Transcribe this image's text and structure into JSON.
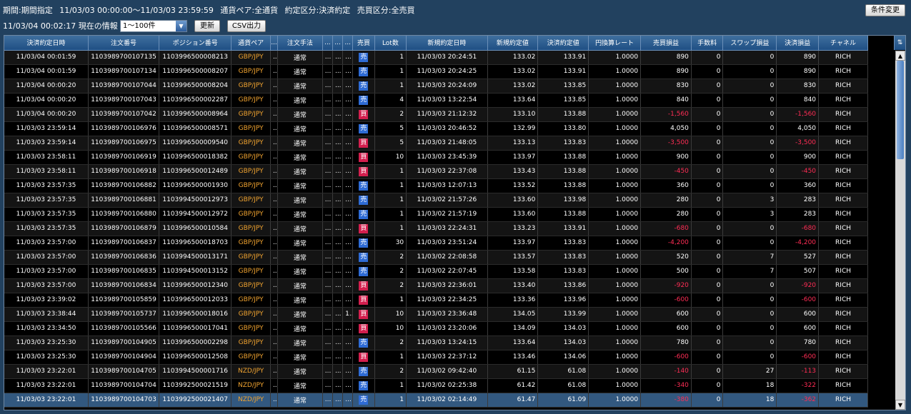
{
  "header": {
    "period_label": "期間:期間指定",
    "period_value": "11/03/03 00:00:00〜11/03/03 23:59:59",
    "pair_filter": "通貨ペア:全通貨",
    "execution_filter": "約定区分:決済約定",
    "side_filter": "売買区分:全売買",
    "condition_button": "条件変更",
    "current_info": "11/03/04 00:02:17 現在の情報",
    "range_value": "1〜100件",
    "update_button": "更新",
    "csv_button": "CSV出力"
  },
  "columns": [
    "決済約定日時",
    "注文番号",
    "ポジション番号",
    "通貨ペア",
    "...",
    "注文手法",
    "...",
    "...",
    "...",
    "売買",
    "Lot数",
    "新規約定日時",
    "新規約定値",
    "決済約定値",
    "円換算レート",
    "売買損益",
    "手数料",
    "スワップ損益",
    "決済損益",
    "チャネル"
  ],
  "rows": [
    [
      "11/03/04 00:01:59",
      "1103989700107135",
      "1103996500008213",
      "GBP/JPY",
      "...",
      "通常",
      "...",
      "...",
      "...",
      "売",
      "1",
      "11/03/03 20:24:51",
      "133.02",
      "133.91",
      "1.0000",
      "890",
      "0",
      "0",
      "890",
      "RICH"
    ],
    [
      "11/03/04 00:01:59",
      "1103989700107134",
      "1103996500008207",
      "GBP/JPY",
      "...",
      "通常",
      "...",
      "...",
      "...",
      "売",
      "1",
      "11/03/03 20:24:25",
      "133.02",
      "133.91",
      "1.0000",
      "890",
      "0",
      "0",
      "890",
      "RICH"
    ],
    [
      "11/03/04 00:00:20",
      "1103989700107044",
      "1103996500008204",
      "GBP/JPY",
      "...",
      "通常",
      "...",
      "...",
      "...",
      "売",
      "1",
      "11/03/03 20:24:09",
      "133.02",
      "133.85",
      "1.0000",
      "830",
      "0",
      "0",
      "830",
      "RICH"
    ],
    [
      "11/03/04 00:00:20",
      "1103989700107043",
      "1103996500002287",
      "GBP/JPY",
      "...",
      "通常",
      "...",
      "...",
      "...",
      "売",
      "4",
      "11/03/03 13:22:54",
      "133.64",
      "133.85",
      "1.0000",
      "840",
      "0",
      "0",
      "840",
      "RICH"
    ],
    [
      "11/03/04 00:00:20",
      "1103989700107042",
      "1103996500008964",
      "GBP/JPY",
      "...",
      "通常",
      "...",
      "...",
      "...",
      "買",
      "2",
      "11/03/03 21:12:32",
      "133.10",
      "133.88",
      "1.0000",
      "-1,560",
      "0",
      "0",
      "-1,560",
      "RICH"
    ],
    [
      "11/03/03 23:59:14",
      "1103989700106976",
      "1103996500008571",
      "GBP/JPY",
      "...",
      "通常",
      "...",
      "...",
      "...",
      "売",
      "5",
      "11/03/03 20:46:52",
      "132.99",
      "133.80",
      "1.0000",
      "4,050",
      "0",
      "0",
      "4,050",
      "RICH"
    ],
    [
      "11/03/03 23:59:14",
      "1103989700106975",
      "1103996500009540",
      "GBP/JPY",
      "...",
      "通常",
      "...",
      "...",
      "...",
      "買",
      "5",
      "11/03/03 21:48:05",
      "133.13",
      "133.83",
      "1.0000",
      "-3,500",
      "0",
      "0",
      "-3,500",
      "RICH"
    ],
    [
      "11/03/03 23:58:11",
      "1103989700106919",
      "1103996500018382",
      "GBP/JPY",
      "...",
      "通常",
      "...",
      "...",
      "...",
      "買",
      "10",
      "11/03/03 23:45:39",
      "133.97",
      "133.88",
      "1.0000",
      "900",
      "0",
      "0",
      "900",
      "RICH"
    ],
    [
      "11/03/03 23:58:11",
      "1103989700106918",
      "1103996500012489",
      "GBP/JPY",
      "...",
      "通常",
      "...",
      "...",
      "...",
      "買",
      "1",
      "11/03/03 22:37:08",
      "133.43",
      "133.88",
      "1.0000",
      "-450",
      "0",
      "0",
      "-450",
      "RICH"
    ],
    [
      "11/03/03 23:57:35",
      "1103989700106882",
      "1103996500001930",
      "GBP/JPY",
      "...",
      "通常",
      "...",
      "...",
      "...",
      "売",
      "1",
      "11/03/03 12:07:13",
      "133.52",
      "133.88",
      "1.0000",
      "360",
      "0",
      "0",
      "360",
      "RICH"
    ],
    [
      "11/03/03 23:57:35",
      "1103989700106881",
      "1103994500012973",
      "GBP/JPY",
      "...",
      "通常",
      "...",
      "...",
      "...",
      "売",
      "1",
      "11/03/02 21:57:26",
      "133.60",
      "133.98",
      "1.0000",
      "280",
      "0",
      "3",
      "283",
      "RICH"
    ],
    [
      "11/03/03 23:57:35",
      "1103989700106880",
      "1103994500012972",
      "GBP/JPY",
      "...",
      "通常",
      "...",
      "...",
      "...",
      "売",
      "1",
      "11/03/02 21:57:19",
      "133.60",
      "133.88",
      "1.0000",
      "280",
      "0",
      "3",
      "283",
      "RICH"
    ],
    [
      "11/03/03 23:57:35",
      "1103989700106879",
      "1103996500010584",
      "GBP/JPY",
      "...",
      "通常",
      "...",
      "...",
      "...",
      "買",
      "1",
      "11/03/03 22:24:31",
      "133.23",
      "133.91",
      "1.0000",
      "-680",
      "0",
      "0",
      "-680",
      "RICH"
    ],
    [
      "11/03/03 23:57:00",
      "1103989700106837",
      "1103996500018703",
      "GBP/JPY",
      "...",
      "通常",
      "...",
      "...",
      "...",
      "売",
      "30",
      "11/03/03 23:51:24",
      "133.97",
      "133.83",
      "1.0000",
      "-4,200",
      "0",
      "0",
      "-4,200",
      "RICH"
    ],
    [
      "11/03/03 23:57:00",
      "1103989700106836",
      "1103994500013171",
      "GBP/JPY",
      "...",
      "通常",
      "...",
      "...",
      "...",
      "売",
      "2",
      "11/03/02 22:08:58",
      "133.57",
      "133.83",
      "1.0000",
      "520",
      "0",
      "7",
      "527",
      "RICH"
    ],
    [
      "11/03/03 23:57:00",
      "1103989700106835",
      "1103994500013152",
      "GBP/JPY",
      "...",
      "通常",
      "...",
      "...",
      "...",
      "売",
      "2",
      "11/03/02 22:07:45",
      "133.58",
      "133.83",
      "1.0000",
      "500",
      "0",
      "7",
      "507",
      "RICH"
    ],
    [
      "11/03/03 23:57:00",
      "1103989700106834",
      "1103996500012340",
      "GBP/JPY",
      "...",
      "通常",
      "...",
      "...",
      "...",
      "買",
      "2",
      "11/03/03 22:36:01",
      "133.40",
      "133.86",
      "1.0000",
      "-920",
      "0",
      "0",
      "-920",
      "RICH"
    ],
    [
      "11/03/03 23:39:02",
      "1103989700105859",
      "1103996500012033",
      "GBP/JPY",
      "...",
      "通常",
      "...",
      "...",
      "...",
      "買",
      "1",
      "11/03/03 22:34:25",
      "133.36",
      "133.96",
      "1.0000",
      "-600",
      "0",
      "0",
      "-600",
      "RICH"
    ],
    [
      "11/03/03 23:38:44",
      "1103989700105737",
      "1103996500018016",
      "GBP/JPY",
      "...",
      "通常",
      "...",
      "...",
      "1...",
      "買",
      "10",
      "11/03/03 23:36:48",
      "134.05",
      "133.99",
      "1.0000",
      "600",
      "0",
      "0",
      "600",
      "RICH"
    ],
    [
      "11/03/03 23:34:50",
      "1103989700105566",
      "1103996500017041",
      "GBP/JPY",
      "...",
      "通常",
      "...",
      "...",
      "...",
      "買",
      "10",
      "11/03/03 23:20:06",
      "134.09",
      "134.03",
      "1.0000",
      "600",
      "0",
      "0",
      "600",
      "RICH"
    ],
    [
      "11/03/03 23:25:30",
      "1103989700104905",
      "1103996500002298",
      "GBP/JPY",
      "...",
      "通常",
      "...",
      "...",
      "...",
      "売",
      "2",
      "11/03/03 13:24:15",
      "133.64",
      "134.03",
      "1.0000",
      "780",
      "0",
      "0",
      "780",
      "RICH"
    ],
    [
      "11/03/03 23:25:30",
      "1103989700104904",
      "1103996500012508",
      "GBP/JPY",
      "...",
      "通常",
      "...",
      "...",
      "...",
      "買",
      "1",
      "11/03/03 22:37:12",
      "133.46",
      "134.06",
      "1.0000",
      "-600",
      "0",
      "0",
      "-600",
      "RICH"
    ],
    [
      "11/03/03 23:22:01",
      "1103989700104705",
      "1103994500001716",
      "NZD/JPY",
      "...",
      "通常",
      "...",
      "...",
      "...",
      "売",
      "2",
      "11/03/02 09:42:40",
      "61.15",
      "61.08",
      "1.0000",
      "-140",
      "0",
      "27",
      "-113",
      "RICH"
    ],
    [
      "11/03/03 23:22:01",
      "1103989700104704",
      "1103992500021519",
      "NZD/JPY",
      "...",
      "通常",
      "...",
      "...",
      "...",
      "売",
      "1",
      "11/03/02 02:25:38",
      "61.42",
      "61.08",
      "1.0000",
      "-340",
      "0",
      "18",
      "-322",
      "RICH"
    ],
    [
      "11/03/03 23:22:01",
      "1103989700104703",
      "1103992500021407",
      "NZD/JPY",
      "...",
      "通常",
      "...",
      "...",
      "...",
      "売",
      "1",
      "11/03/02 02:14:49",
      "61.47",
      "61.09",
      "1.0000",
      "-380",
      "0",
      "18",
      "-362",
      "RICH"
    ]
  ],
  "selected_row_index": 24,
  "colors": {
    "negative": "#ff2d55",
    "pair": "#f0a330",
    "sell_badge": "#2e6bd4",
    "buy_badge": "#d21f4e",
    "selected_row": "#32587f"
  },
  "icons": {
    "scroll_up": "triangle-up-icon",
    "scroll_down": "triangle-down-icon",
    "column_settings": "column-settings-icon"
  }
}
